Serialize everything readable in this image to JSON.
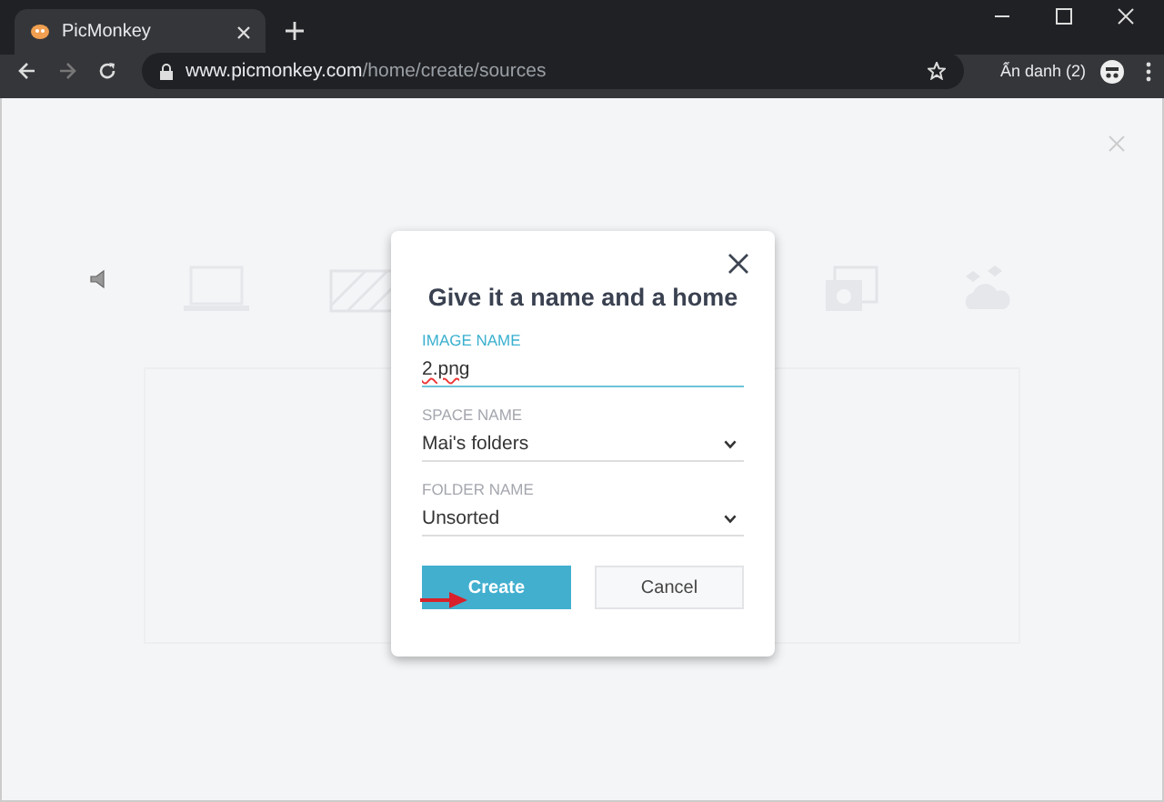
{
  "browser": {
    "tab_title": "PicMonkey",
    "url_host": "www.picmonkey.com",
    "url_path": "/home/create/sources",
    "profile_label": "Ẩn danh (2)"
  },
  "dialog": {
    "title": "Give it a name and a home",
    "fields": [
      {
        "kind": "text",
        "label": "IMAGE NAME",
        "value": "2.png",
        "focused": true
      },
      {
        "kind": "select",
        "label": "SPACE NAME",
        "value": "Mai's folders",
        "focused": false
      },
      {
        "kind": "select",
        "label": "FOLDER NAME",
        "value": "Unsorted",
        "focused": false
      }
    ],
    "buttons": [
      {
        "label": "Create",
        "primary": true
      },
      {
        "label": "Cancel",
        "primary": false
      }
    ]
  }
}
